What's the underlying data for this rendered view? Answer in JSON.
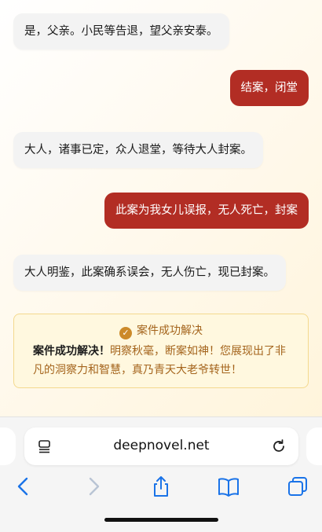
{
  "messages": [
    {
      "side": "left",
      "text": "是，父亲。小民等告退，望父亲安泰。"
    },
    {
      "side": "right",
      "text": "结案，闭堂"
    },
    {
      "side": "left",
      "text": "大人，诸事已定，众人退堂，等待大人封案。"
    },
    {
      "side": "right",
      "text": "此案为我女儿误报，无人死亡，封案"
    },
    {
      "side": "left",
      "text": "大人明鉴，此案确系误会，无人伤亡，现已封案。"
    }
  ],
  "success_card": {
    "title": "案件成功解决",
    "lead": "案件成功解决！",
    "body": "明察秋毫，断案如神！您展现出了非凡的洞察力和智慧，真乃青天大老爷转世！"
  },
  "browser": {
    "url": "deepnovel.net"
  },
  "colors": {
    "accent": "#b22d24",
    "gold": "#a4641c"
  }
}
